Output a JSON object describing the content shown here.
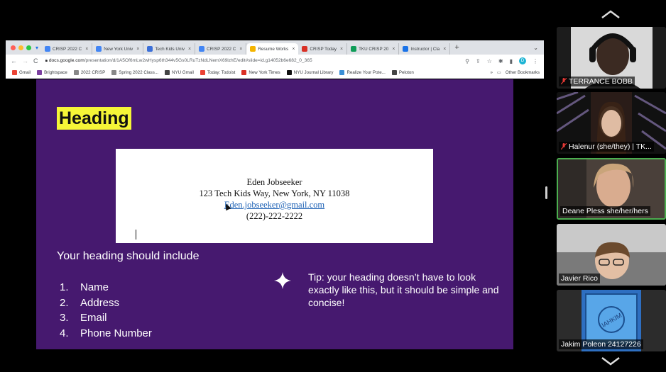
{
  "browser": {
    "tabs": [
      {
        "label": "CRISP 2022 C",
        "color": "#4285f4"
      },
      {
        "label": "New York Univ",
        "color": "#4285f4"
      },
      {
        "label": "Tech Kids Univ",
        "color": "#3b6fd8"
      },
      {
        "label": "CRISP 2022 C",
        "color": "#4285f4"
      },
      {
        "label": "Resume Works",
        "color": "#f4b400",
        "active": true
      },
      {
        "label": "CRISP Today",
        "color": "#d93025"
      },
      {
        "label": "TKU CRISP 20",
        "color": "#0f9d58"
      },
      {
        "label": "Instructor | Cla",
        "color": "#1a73e8"
      }
    ],
    "url_host": "docs.google.com",
    "url_path": "/presentation/d/1A5Of6mLw2wHysp6th344v5Gs0LRuTzNdLNemX69lzhE/edit#slide=id.g14052b6e682_0_365",
    "profile_initial": "D",
    "bookmarks": [
      "Gmail",
      "Brightspace",
      "2022 CRISP",
      "Spring 2022 Class...",
      "NYU Gmail",
      "Today: Todoist",
      "New York Times",
      "NYU Journal Library",
      "Realize Your Pote...",
      "Peloton"
    ],
    "other_bookmarks": "Other Bookmarks"
  },
  "slide": {
    "heading": "Heading",
    "resume": {
      "name": "Eden Jobseeker",
      "address": "123 Tech Kids Way, New York, NY 11038",
      "email": "Eden.jobseeker@gmail.com",
      "phone": "(222)-222-2222"
    },
    "include_title": "Your heading should include",
    "items": [
      {
        "num": "1.",
        "text": "Name"
      },
      {
        "num": "2.",
        "text": "Address"
      },
      {
        "num": "3.",
        "text": "Email"
      },
      {
        "num": "4.",
        "text": "Phone Number"
      }
    ],
    "tip": "Tip: your heading doesn’t have to look exactly like this, but it should be simple and concise!"
  },
  "participants": [
    {
      "name": "TERRANCE BOBB",
      "muted": true
    },
    {
      "name": "Halenur (she/they) | TK...",
      "muted": true
    },
    {
      "name": "Deane Pless she/her/hers",
      "muted": false,
      "speaking": true
    },
    {
      "name": "Javier Rico",
      "muted": false
    },
    {
      "name": "Jakim Poleon 24127226",
      "muted": false
    }
  ],
  "colors": {
    "slide_bg": "#46196f",
    "heading_highlight": "#f5f537",
    "speaking_border": "#4caf50"
  }
}
